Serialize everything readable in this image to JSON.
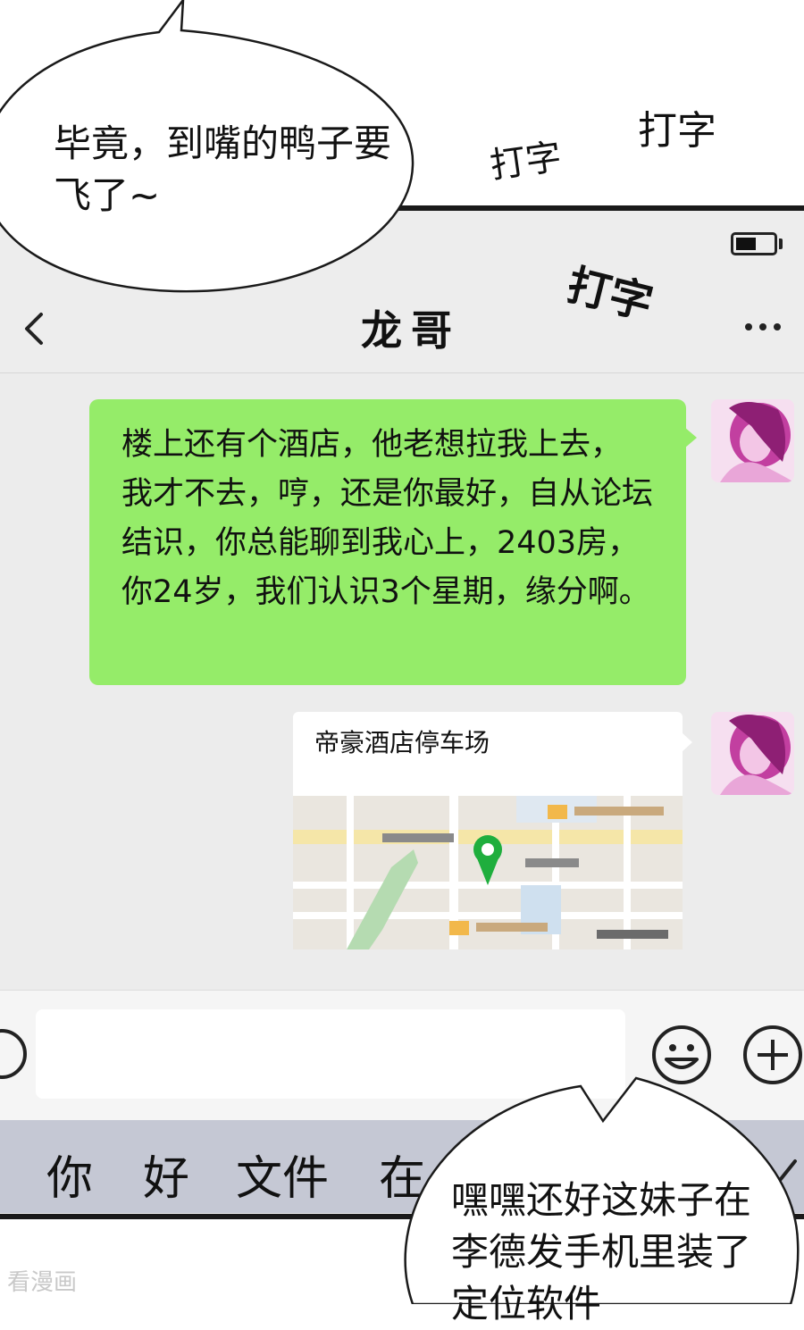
{
  "chat": {
    "title": "龙哥",
    "messages": [
      {
        "type": "text",
        "from": "self",
        "text": "楼上还有个酒店，他老想拉我上去， 我才不去，哼，还是你最好，自从论坛 结识，你总能聊到我心上，2403房， 你24岁，我们认识3个星期，缘分啊。"
      },
      {
        "type": "location",
        "from": "self",
        "title": "帝豪酒店停车场"
      }
    ]
  },
  "keyboard": {
    "suggestions": [
      "你",
      "好",
      "文件",
      "在"
    ]
  },
  "comic": {
    "speech_left": "毕竟，到嘴的鸭子要飞了~",
    "speech_right": "嘿嘿还好这妹子在李德发手机里装了定位软件",
    "sfx": [
      "打字",
      "打字",
      "打字"
    ]
  },
  "watermark": "看漫画",
  "colors": {
    "bubble_green": "#95ec69",
    "chat_bg": "#ececec",
    "suggest_bg": "#c5c8d4"
  }
}
